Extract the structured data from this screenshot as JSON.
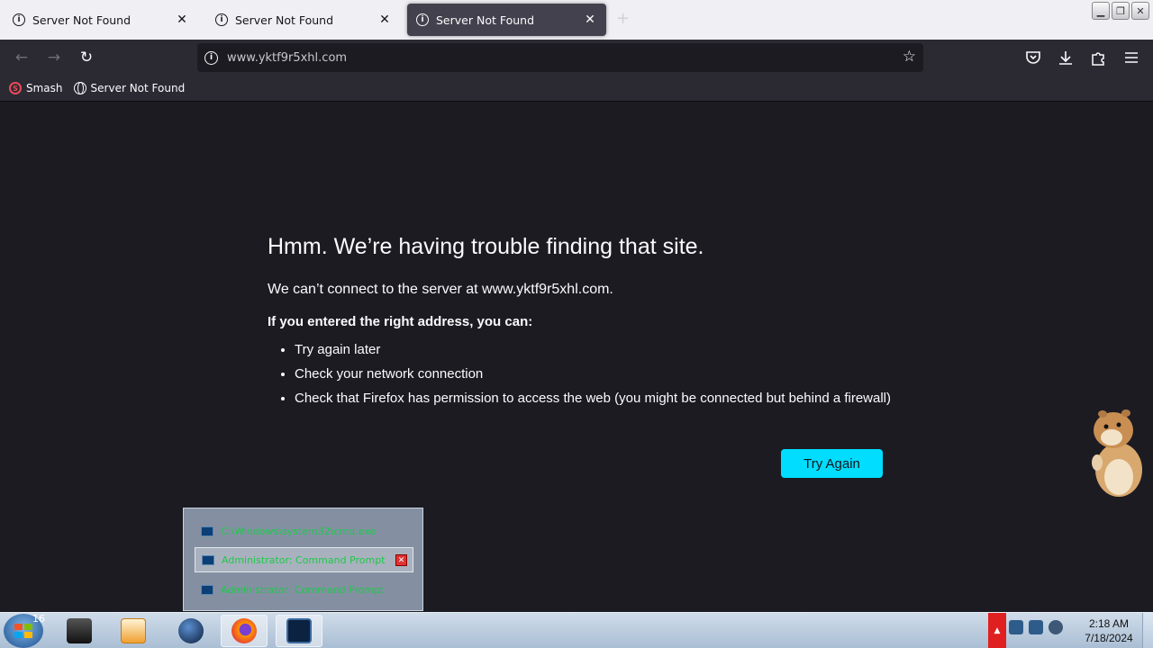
{
  "tabs": [
    {
      "title": "Server Not Found",
      "active": false
    },
    {
      "title": "Server Not Found",
      "active": false
    },
    {
      "title": "Server Not Found",
      "active": true
    }
  ],
  "toolbar": {
    "new_tab": "+",
    "url": "www.yktf9r5xhl.com"
  },
  "bookmarks": [
    {
      "label": "Smash",
      "icon": "smash-logo-icon"
    },
    {
      "label": "Server Not Found",
      "icon": "globe-icon"
    }
  ],
  "error": {
    "title": "Hmm. We’re having trouble finding that site.",
    "message": "We can’t connect to the server at www.yktf9r5xhl.com.",
    "subtitle": "If you entered the right address, you can:",
    "suggestions": [
      "Try again later",
      "Check your network connection",
      "Check that Firefox has permission to access the web (you might be connected but behind a firewall)"
    ],
    "button_label": "Try Again"
  },
  "taskbar_preview": {
    "items": [
      "C:\\Windows\\system32\\cmd.exe",
      "Administrator: Command Prompt",
      "Administrator: Command Prompt"
    ]
  },
  "taskbar": {
    "badge": "16",
    "clock_time": "2:18 AM",
    "clock_date": "7/18/2024"
  },
  "colors": {
    "page_bg": "#1c1b22",
    "toolbar_bg": "#2b2a33",
    "accent_button": "#00ddff"
  }
}
